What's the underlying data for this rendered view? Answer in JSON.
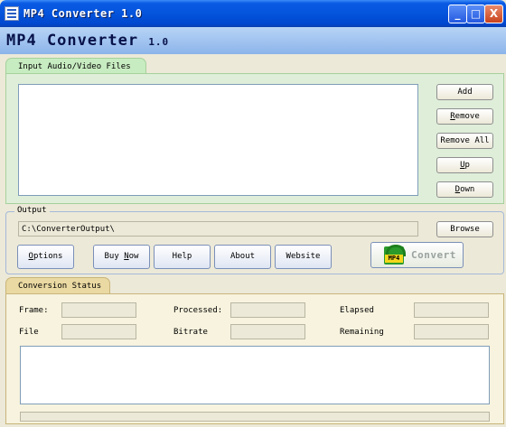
{
  "window": {
    "title": "MP4 Converter 1.0",
    "controls": {
      "minimize": "_",
      "maximize": "□",
      "close": "X"
    }
  },
  "banner": {
    "name": "MP4 Converter",
    "version": "1.0"
  },
  "input_tab": {
    "label": "Input Audio/Video Files",
    "buttons": {
      "add": "Add",
      "remove": "Remove",
      "remove_all": "Remove All",
      "up": "Up",
      "down": "Down"
    }
  },
  "output": {
    "label": "Output",
    "path": "C:\\ConverterOutput\\",
    "browse": "Browse"
  },
  "nav": {
    "options": "Options",
    "buy_now": "Buy Now",
    "help": "Help",
    "about": "About",
    "website": "Website"
  },
  "convert": {
    "icon_text": "MP4",
    "label": "Convert"
  },
  "status": {
    "tab_label": "Conversion Status",
    "frame": "Frame:",
    "processed": "Processed:",
    "elapsed": "Elapsed",
    "file": "File",
    "bitrate": "Bitrate",
    "remaining": "Remaining"
  },
  "colors": {
    "titlebar": "#0454dc",
    "input_panel": "#dfeed9",
    "status_panel": "#f7f3de"
  }
}
